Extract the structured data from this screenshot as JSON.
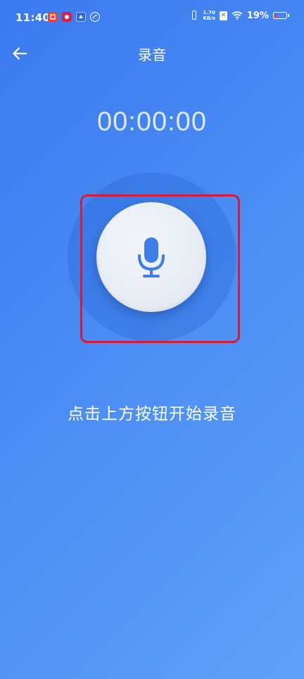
{
  "status_bar": {
    "time": "11:40",
    "notification_icons": [
      "app-icon-red",
      "app-icon-pink",
      "app-icon-blue",
      "app-icon-circle"
    ],
    "net_speed_value": "1.70",
    "net_speed_unit": "KB/s",
    "battery_percent": "19%",
    "battery_level": 0.19
  },
  "header": {
    "title": "录音",
    "back_icon": "arrow-left-icon"
  },
  "timer": {
    "value": "00:00:00"
  },
  "record": {
    "icon": "microphone-icon",
    "accent_color": "#3d7ee8"
  },
  "hint": {
    "text": "点击上方按钮开始录音"
  },
  "colors": {
    "background_start": "#3a79ef",
    "background_end": "#5fa0f8",
    "highlight": "#d7193b"
  }
}
